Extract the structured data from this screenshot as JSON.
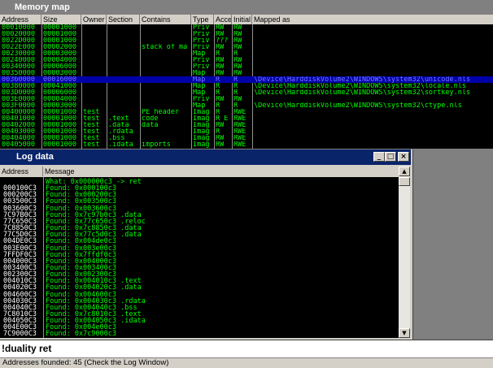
{
  "memory_map": {
    "title": "Memory map",
    "columns": [
      "Address",
      "Size",
      "Owner",
      "Section",
      "Contains",
      "Type",
      "Access",
      "Initial",
      "Mapped as"
    ],
    "rows": [
      [
        "00010000",
        "00001000",
        "",
        "",
        "",
        "Priv",
        "RW",
        "RW",
        ""
      ],
      [
        "00020000",
        "00001000",
        "",
        "",
        "",
        "Priv",
        "RW",
        "RW",
        ""
      ],
      [
        "0022D000",
        "00001000",
        "",
        "",
        "",
        "Priv",
        "???",
        "RW",
        ""
      ],
      [
        "0022E000",
        "00002000",
        "",
        "",
        "stack of ma",
        "Priv",
        "RW",
        "RW",
        ""
      ],
      [
        "00230000",
        "00003000",
        "",
        "",
        "",
        "Map",
        "R",
        "R",
        ""
      ],
      [
        "00240000",
        "00004000",
        "",
        "",
        "",
        "Priv",
        "RW",
        "RW",
        ""
      ],
      [
        "00340000",
        "00006000",
        "",
        "",
        "",
        "Priv",
        "RW",
        "RW",
        ""
      ],
      [
        "00350000",
        "00003000",
        "",
        "",
        "",
        "Map",
        "RW",
        "RW",
        ""
      ],
      [
        "00360000",
        "00016000",
        "",
        "",
        "",
        "Map",
        "R",
        "R",
        "\\Device\\HarddiskVolume2\\WINDOWS\\system32\\unicode.nls"
      ],
      [
        "00380000",
        "00041000",
        "",
        "",
        "",
        "Map",
        "R",
        "R",
        "\\Device\\HarddiskVolume2\\WINDOWS\\system32\\locale.nls"
      ],
      [
        "003D0000",
        "00006000",
        "",
        "",
        "",
        "Map",
        "R",
        "R",
        "\\Device\\HarddiskVolume2\\WINDOWS\\system32\\sortkey.nls"
      ],
      [
        "003E0000",
        "00004000",
        "",
        "",
        "",
        "Priv",
        "RW",
        "RW",
        ""
      ],
      [
        "003F0000",
        "00003000",
        "",
        "",
        "",
        "Map",
        "R",
        "R",
        "\\Device\\HarddiskVolume2\\WINDOWS\\system32\\ctype.nls"
      ],
      [
        "00400000",
        "00001000",
        "test",
        "",
        "PE header",
        "Imag",
        "R",
        "RWE",
        ""
      ],
      [
        "00401000",
        "00001000",
        "test",
        ".text",
        "code",
        "Imag",
        "R E",
        "RWE",
        ""
      ],
      [
        "00402000",
        "00001000",
        "test",
        ".data",
        "data",
        "Imag",
        "RW",
        "RWE",
        ""
      ],
      [
        "00403000",
        "00001000",
        "test",
        ".rdata",
        "",
        "Imag",
        "R",
        "RWE",
        ""
      ],
      [
        "00404000",
        "00001000",
        "test",
        ".bss",
        "",
        "Imag",
        "RW",
        "RWE",
        ""
      ],
      [
        "00405000",
        "00001000",
        "test",
        ".idata",
        "imports",
        "Imag",
        "RW",
        "RWE",
        ""
      ]
    ],
    "selected_row": 8
  },
  "log": {
    "title": "Log data",
    "columns": [
      "Address",
      "Message"
    ],
    "rows": [
      [
        "",
        "What: 0x000000c3 -> ret"
      ],
      [
        "000100C3",
        "Found: 0x000100c3"
      ],
      [
        "000200C3",
        "Found: 0x000200c3"
      ],
      [
        "003500C3",
        "Found: 0x003500c3"
      ],
      [
        "003600C3",
        "Found: 0x003600c3"
      ],
      [
        "7C97B0C3",
        "Found: 0x7c97b0c3 .data"
      ],
      [
        "77C650C3",
        "Found: 0x77c650c3 .reloc"
      ],
      [
        "7C8850C3",
        "Found: 0x7c8850c3 .data"
      ],
      [
        "77C5D0C3",
        "Found: 0x77c5d0c3 .data"
      ],
      [
        "004DE0C3",
        "Found: 0x004de0c3"
      ],
      [
        "003E00C3",
        "Found: 0x003e00c3"
      ],
      [
        "7FFDF0C3",
        "Found: 0x7ffdf0c3"
      ],
      [
        "004000C3",
        "Found: 0x004000c3"
      ],
      [
        "003400C3",
        "Found: 0x003400c3"
      ],
      [
        "002300C3",
        "Found: 0x002300c3"
      ],
      [
        "004010C3",
        "Found: 0x004010c3 .text"
      ],
      [
        "004020C3",
        "Found: 0x004020c3 .data"
      ],
      [
        "004600C3",
        "Found: 0x004600c3"
      ],
      [
        "004030C3",
        "Found: 0x004030c3 .rdata"
      ],
      [
        "004040C3",
        "Found: 0x004040c3 .bss"
      ],
      [
        "7C8010C3",
        "Found: 0x7c8010c3 .text"
      ],
      [
        "004050C3",
        "Found: 0x004050c3 .idata"
      ],
      [
        "004E00C3",
        "Found: 0x004e00c3"
      ],
      [
        "7C9000C3",
        "Found: 0x7c9000c3"
      ]
    ],
    "buttons": {
      "minimize": "_",
      "maximize": "□",
      "close": "×"
    }
  },
  "command": {
    "value": "!duality ret"
  },
  "status": {
    "text": "Addresses founded: 45 (Check the Log Window)"
  },
  "colors": {
    "text_green": "#00ff00",
    "selection": "#0000a8",
    "title_active": "#0a246a",
    "title_inactive": "#808080"
  }
}
